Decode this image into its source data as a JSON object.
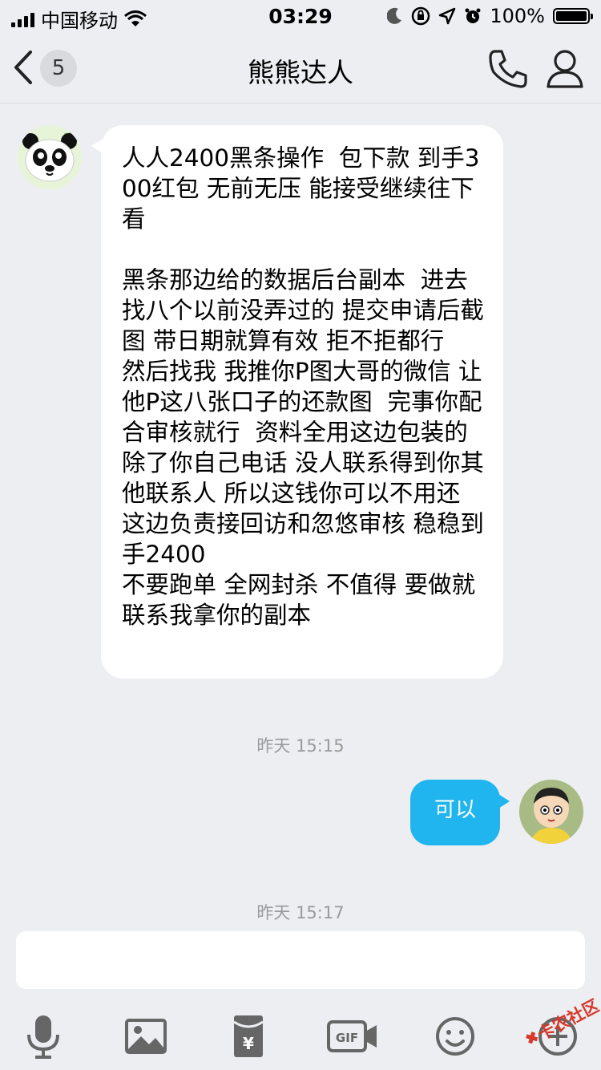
{
  "status_bar": {
    "carrier": "中国移动",
    "time": "03:29",
    "battery_percent": "100%"
  },
  "nav": {
    "unread_count": "5",
    "title": "熊熊达人"
  },
  "messages": [
    {
      "side": "left",
      "text": "人人2400黑条操作  包下款 到手300红包 无前无压 能接受继续往下看\n\n黑条那边给的数据后台副本  进去找八个以前没弄过的 提交申请后截图 带日期就算有效 拒不拒都行   然后找我 我推你P图大哥的微信 让他P这八张口子的还款图  完事你配合审核就行  资料全用这边包装的 除了你自己电话 没人联系得到你其他联系人 所以这钱你可以不用还 这边负责接回访和忽悠审核 稳稳到手2400\n不要跑单 全网封杀 不值得 要做就联系我拿你的副本"
    },
    {
      "side": "right",
      "text": "可以"
    }
  ],
  "timestamps": [
    "昨天 15:15",
    "昨天 15:17"
  ],
  "input": {
    "placeholder": ""
  },
  "watermark": {
    "text": "卡农社区"
  },
  "colors": {
    "background": "#eceef1",
    "sent_bubble": "#20b5ee",
    "received_bubble": "#ffffff",
    "timestamp": "#9a9a9a",
    "icon": "#666666"
  },
  "icons": [
    "back-chevron-icon",
    "phone-icon",
    "person-icon",
    "microphone-icon",
    "image-icon",
    "red-envelope-icon",
    "gif-icon",
    "emoji-icon"
  ]
}
